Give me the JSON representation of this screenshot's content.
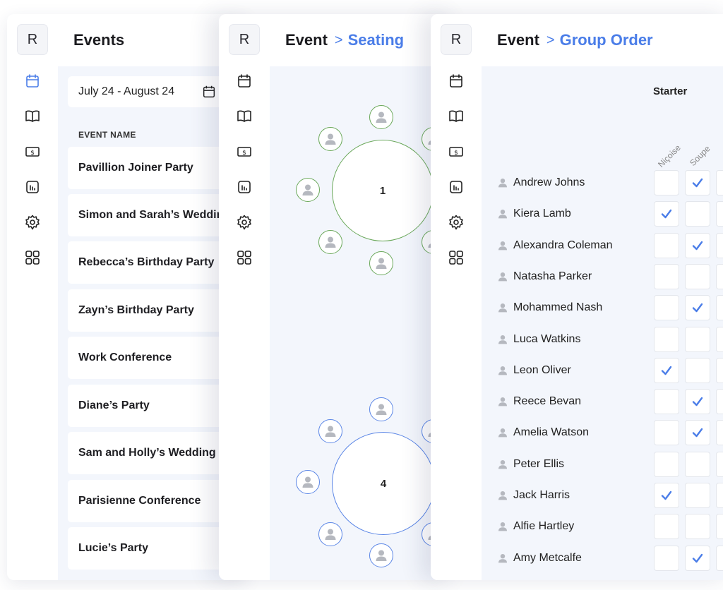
{
  "colors": {
    "accent": "#4a7de8",
    "table_green": "#6aa85a",
    "table_blue": "#5b86e6",
    "content_bg": "#f3f6fc"
  },
  "icons": [
    "calendar-icon",
    "book-icon",
    "dollar-icon",
    "chart-icon",
    "gear-icon",
    "grid-icon",
    "person-icon",
    "checkmark-icon"
  ],
  "logo": "R",
  "events_panel": {
    "title": "Events",
    "date_range": "July 24 - August 24",
    "column_label": "EVENT NAME",
    "events": [
      "Pavillion Joiner Party",
      "Simon and Sarah’s Wedding",
      "Rebecca’s Birthday Party",
      "Zayn’s Birthday Party",
      "Work Conference",
      "Diane’s Party",
      "Sam and Holly’s Wedding",
      "Parisienne Conference",
      "Lucie’s Party"
    ]
  },
  "seating_panel": {
    "breadcrumb_root": "Event",
    "breadcrumb_sep": ">",
    "breadcrumb_current": "Seating",
    "tables": [
      {
        "number": "1",
        "color": "green"
      },
      {
        "number": "4",
        "color": "blue"
      }
    ]
  },
  "group_order_panel": {
    "breadcrumb_root": "Event",
    "breadcrumb_sep": ">",
    "breadcrumb_current": "Group Order",
    "course": "Starter",
    "dishes": [
      "Niçoise",
      "Soupe"
    ],
    "guests": [
      {
        "name": "Andrew Johns",
        "checks": [
          false,
          true,
          false
        ]
      },
      {
        "name": "Kiera Lamb",
        "checks": [
          true,
          false,
          false
        ]
      },
      {
        "name": "Alexandra Coleman",
        "checks": [
          false,
          true,
          false
        ]
      },
      {
        "name": "Natasha Parker",
        "checks": [
          false,
          false,
          false
        ]
      },
      {
        "name": "Mohammed Nash",
        "checks": [
          false,
          true,
          false
        ]
      },
      {
        "name": "Luca Watkins",
        "checks": [
          false,
          false,
          false
        ]
      },
      {
        "name": "Leon Oliver",
        "checks": [
          true,
          false,
          false
        ]
      },
      {
        "name": "Reece Bevan",
        "checks": [
          false,
          true,
          false
        ]
      },
      {
        "name": "Amelia Watson",
        "checks": [
          false,
          true,
          false
        ]
      },
      {
        "name": "Peter Ellis",
        "checks": [
          false,
          false,
          false
        ]
      },
      {
        "name": "Jack Harris",
        "checks": [
          true,
          false,
          false
        ]
      },
      {
        "name": "Alfie Hartley",
        "checks": [
          false,
          false,
          false
        ]
      },
      {
        "name": "Amy Metcalfe",
        "checks": [
          false,
          true,
          false
        ]
      }
    ]
  }
}
